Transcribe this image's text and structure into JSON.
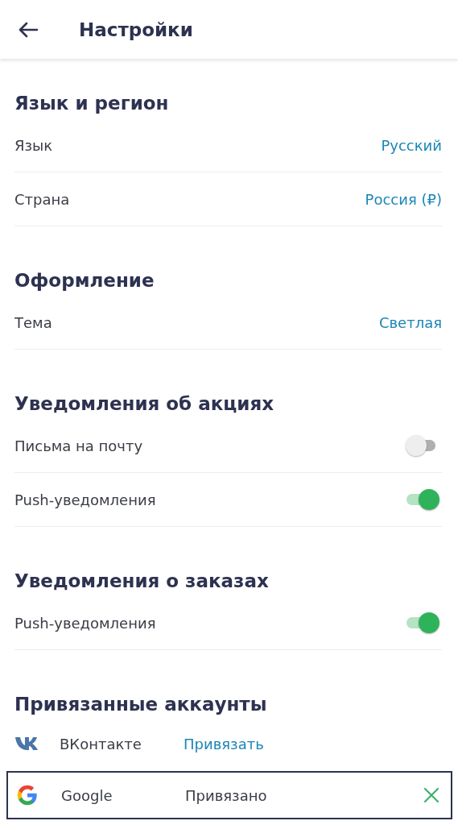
{
  "header": {
    "title": "Настройки"
  },
  "sections": [
    {
      "title": "Язык и регион",
      "rows": [
        {
          "kind": "value",
          "label": "Язык",
          "value": "Русский"
        },
        {
          "kind": "value",
          "label": "Страна",
          "value": "Россия (₽)"
        }
      ]
    },
    {
      "title": "Оформление",
      "rows": [
        {
          "kind": "value",
          "label": "Тема",
          "value": "Светлая"
        }
      ]
    },
    {
      "title": "Уведомления об акциях",
      "rows": [
        {
          "kind": "toggle",
          "label": "Письма на почту",
          "on": false
        },
        {
          "kind": "toggle",
          "label": "Push-уведомления",
          "on": true
        }
      ]
    },
    {
      "title": "Уведомления о заказах",
      "rows": [
        {
          "kind": "toggle",
          "label": "Push-уведомления",
          "on": true
        }
      ]
    }
  ],
  "accounts": {
    "title": "Привязанные аккаунты",
    "items": [
      {
        "kind": "vk",
        "name": "ВКонтакте",
        "status": "Привязать",
        "linked": false,
        "focused": false
      },
      {
        "kind": "google",
        "name": "Google",
        "status": "Привязано",
        "linked": true,
        "focused": true
      }
    ]
  }
}
